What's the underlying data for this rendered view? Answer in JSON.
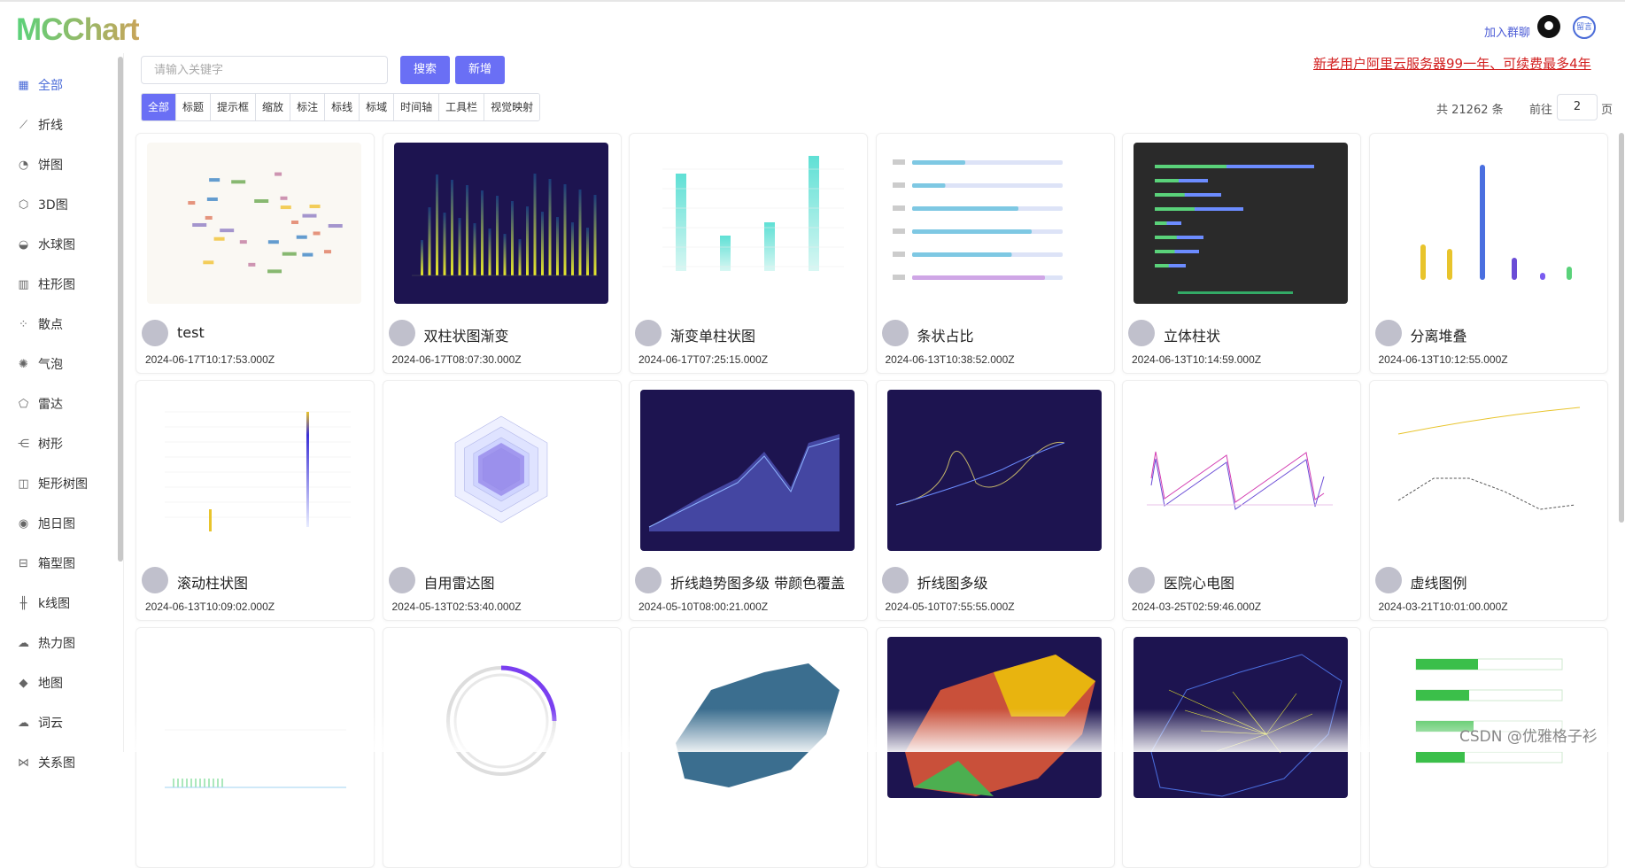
{
  "header": {
    "logo": "MCChart",
    "join_label": "加入群聊",
    "github_icon": "github-icon",
    "user_avatar_text": "留言"
  },
  "sidebar": {
    "items": [
      {
        "label": "全部",
        "icon": "grid-icon",
        "glyph": "▦",
        "active": true
      },
      {
        "label": "折线",
        "icon": "line-chart-icon",
        "glyph": "⟋"
      },
      {
        "label": "饼图",
        "icon": "pie-chart-icon",
        "glyph": "◔"
      },
      {
        "label": "3D图",
        "icon": "cube-icon",
        "glyph": "⬡"
      },
      {
        "label": "水球图",
        "icon": "liquid-ball-icon",
        "glyph": "◒"
      },
      {
        "label": "柱形图",
        "icon": "bar-chart-icon",
        "glyph": "▥"
      },
      {
        "label": "散点",
        "icon": "scatter-icon",
        "glyph": "⁘"
      },
      {
        "label": "气泡",
        "icon": "bubble-icon",
        "glyph": "✺"
      },
      {
        "label": "雷达",
        "icon": "radar-icon",
        "glyph": "⬠"
      },
      {
        "label": "树形",
        "icon": "tree-icon",
        "glyph": "⋲"
      },
      {
        "label": "矩形树图",
        "icon": "treemap-icon",
        "glyph": "◫"
      },
      {
        "label": "旭日图",
        "icon": "sunburst-icon",
        "glyph": "◉"
      },
      {
        "label": "箱型图",
        "icon": "boxplot-icon",
        "glyph": "⊟"
      },
      {
        "label": "k线图",
        "icon": "candlestick-icon",
        "glyph": "╫"
      },
      {
        "label": "热力图",
        "icon": "heatmap-icon",
        "glyph": "☁"
      },
      {
        "label": "地图",
        "icon": "map-icon",
        "glyph": "◆"
      },
      {
        "label": "词云",
        "icon": "wordcloud-icon",
        "glyph": "☁"
      },
      {
        "label": "关系图",
        "icon": "graph-icon",
        "glyph": "⋈"
      }
    ]
  },
  "search": {
    "placeholder": "请输入关键字",
    "search_label": "搜索",
    "add_label": "新增"
  },
  "promo": "新老用户阿里云服务器99一年、可续费最多4年",
  "filters": [
    "全部",
    "标题",
    "提示框",
    "缩放",
    "标注",
    "标线",
    "标域",
    "时间轴",
    "工具栏",
    "视觉映射"
  ],
  "pagination": {
    "total": "共 21262 条",
    "goto_prefix": "前往",
    "page": "2",
    "goto_suffix": "页"
  },
  "cards": [
    {
      "name": "test",
      "date": "2024-06-17T10:17:53.000Z",
      "thumb": "wordcloud"
    },
    {
      "name": "双柱状图渐变",
      "date": "2024-06-17T08:07:30.000Z",
      "thumb": "dualbar"
    },
    {
      "name": "渐变单柱状图",
      "date": "2024-06-17T07:25:15.000Z",
      "thumb": "singlebar"
    },
    {
      "name": "条状占比",
      "date": "2024-06-13T10:38:52.000Z",
      "thumb": "hbar"
    },
    {
      "name": "立体柱状",
      "date": "2024-06-13T10:14:59.000Z",
      "thumb": "stackdark"
    },
    {
      "name": "分离堆叠",
      "date": "2024-06-13T10:12:55.000Z",
      "thumb": "pillars"
    },
    {
      "name": "滚动柱状图",
      "date": "2024-06-13T10:09:02.000Z",
      "thumb": "scrollbar"
    },
    {
      "name": "自用雷达图",
      "date": "2024-05-13T02:53:40.000Z",
      "thumb": "radar"
    },
    {
      "name": "折线趋势图多级 带颜色覆盖",
      "date": "2024-05-10T08:00:21.000Z",
      "thumb": "area"
    },
    {
      "name": "折线图多级",
      "date": "2024-05-10T07:55:55.000Z",
      "thumb": "multiline"
    },
    {
      "name": "医院心电图",
      "date": "2024-03-25T02:59:46.000Z",
      "thumb": "ecg"
    },
    {
      "name": "虚线图例",
      "date": "2024-03-21T10:01:00.000Z",
      "thumb": "dashed"
    },
    {
      "name": "",
      "date": "",
      "thumb": "lollipop"
    },
    {
      "name": "",
      "date": "",
      "thumb": "ring"
    },
    {
      "name": "",
      "date": "",
      "thumb": "map"
    },
    {
      "name": "",
      "date": "",
      "thumb": "mapcolor"
    },
    {
      "name": "",
      "date": "",
      "thumb": "mapflow"
    },
    {
      "name": "",
      "date": "",
      "thumb": "progress"
    }
  ],
  "watermark": "CSDN @优雅格子衫",
  "colors": {
    "accent": "#6a6ff5",
    "promo": "#d21f1f",
    "dark_thumb": "#1d1450"
  }
}
